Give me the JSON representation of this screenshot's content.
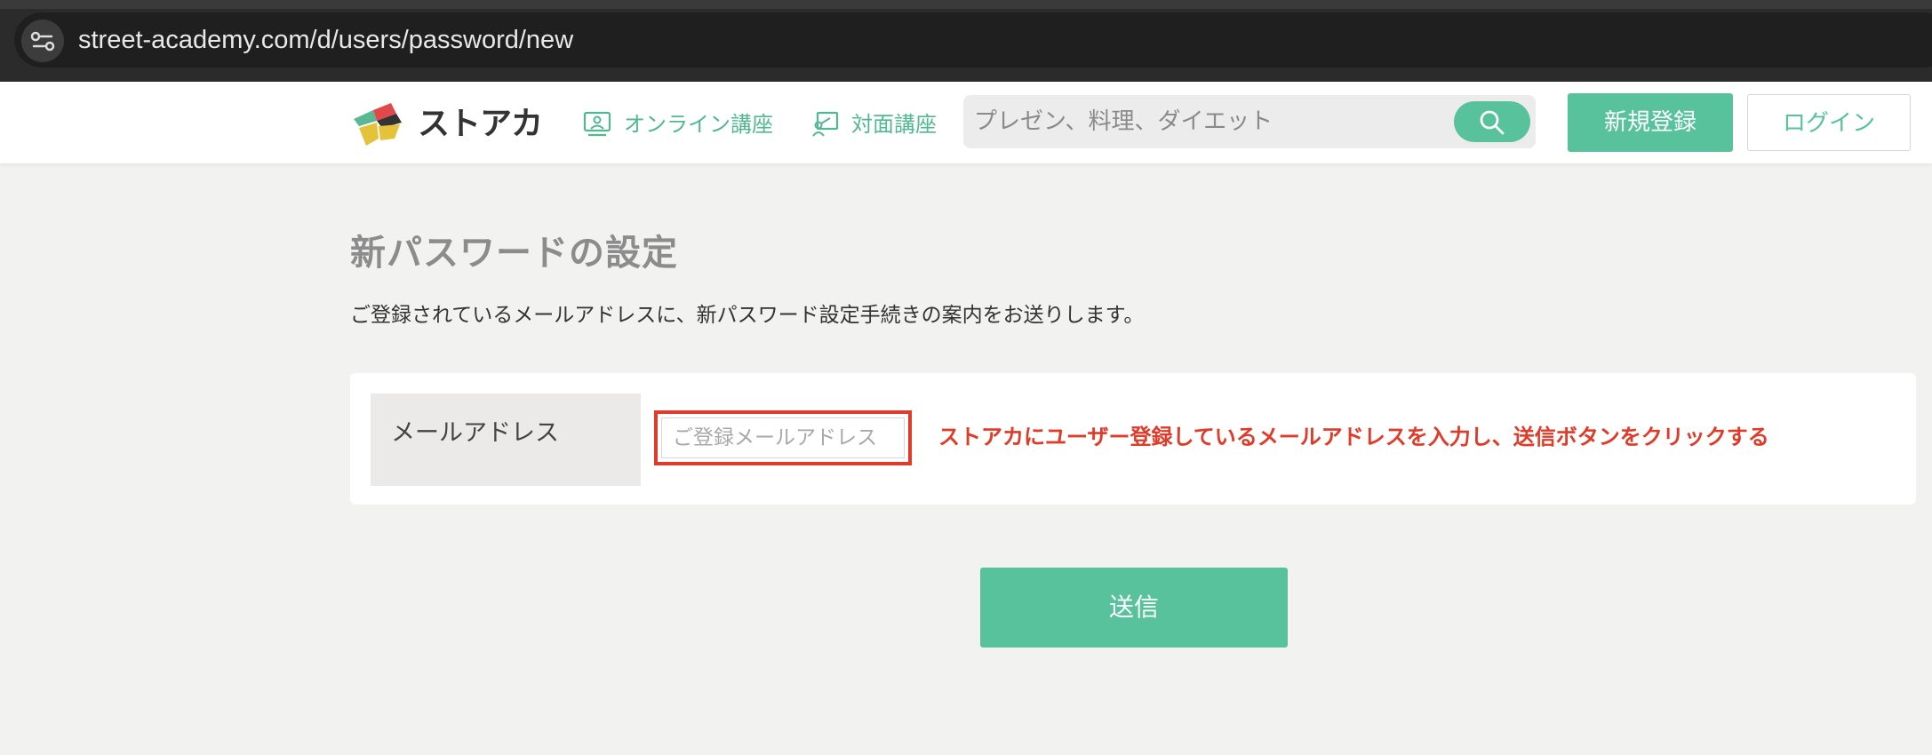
{
  "browser": {
    "url": "street-academy.com/d/users/password/new",
    "site_info_icon": "tune-icon"
  },
  "header": {
    "logo_text": "ストアカ",
    "nav": [
      {
        "label": "オンライン講座",
        "icon": "monitor-person-icon"
      },
      {
        "label": "対面講座",
        "icon": "board-person-icon"
      }
    ],
    "search_placeholder": "プレゼン、料理、ダイエット",
    "search_icon": "search-icon",
    "register_label": "新規登録",
    "login_label": "ログイン"
  },
  "main": {
    "title": "新パスワードの設定",
    "description": "ご登録されているメールアドレスに、新パスワード設定手続きの案内をお送りします。",
    "email_label": "メールアドレス",
    "email_value": "",
    "email_placeholder": "ご登録メールアドレス",
    "annotation": "ストアカにユーザー登録しているメールアドレスを入力し、送信ボタンをクリックする",
    "submit_label": "送信"
  },
  "colors": {
    "accent": "#57c29c",
    "annotation_red": "#e03a28",
    "browser_bg": "#2b2b2b",
    "page_bg": "#f2f2f1"
  }
}
